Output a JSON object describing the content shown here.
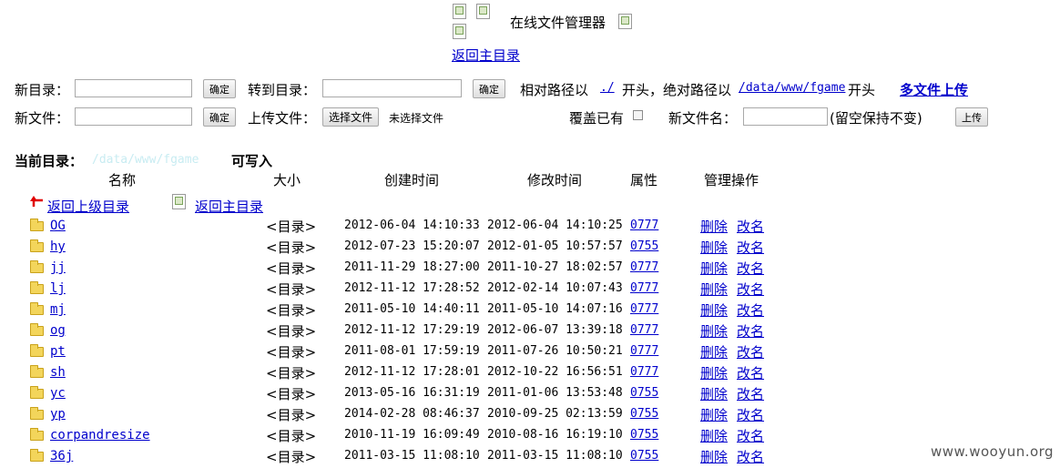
{
  "header": {
    "title": "在线文件管理器",
    "back_main": "返回主目录"
  },
  "toolbar": {
    "new_dir_label": "新目录：",
    "confirm": "确定",
    "goto_dir_label": "转到目录：",
    "path_hint_prefix": "相对路径以",
    "path_hint_rel": "./",
    "path_hint_mid": "开头，绝对路径以",
    "path_hint_abs": "/data/www/fgame",
    "path_hint_suffix": "开头",
    "multi_upload": "多文件上传",
    "new_file_label": "新文件：",
    "upload_file_label": "上传文件：",
    "choose_file": "选择文件",
    "no_file_chosen": "未选择文件",
    "overwrite_label": "覆盖已有",
    "new_filename_label": "新文件名：",
    "keep_hint": "(留空保持不变)",
    "upload_button": "上传"
  },
  "current_dir": {
    "label": "当前目录：",
    "path": "/data/www/fgame",
    "writable": "可写入"
  },
  "table": {
    "columns": [
      "名称",
      "大小",
      "创建时间",
      "修改时间",
      "属性",
      "管理操作"
    ],
    "up_level": "返回上级目录",
    "back_main": "返回主目录",
    "rows": [
      {
        "name": "OG",
        "size": "<目录>",
        "ctime": "2012-06-04 14:10:33",
        "mtime": "2012-06-04 14:10:25",
        "perm": "0777",
        "del": "删除",
        "ren": "改名"
      },
      {
        "name": "hy",
        "size": "<目录>",
        "ctime": "2012-07-23 15:20:07",
        "mtime": "2012-01-05 10:57:57",
        "perm": "0755",
        "del": "删除",
        "ren": "改名"
      },
      {
        "name": "jj",
        "size": "<目录>",
        "ctime": "2011-11-29 18:27:00",
        "mtime": "2011-10-27 18:02:57",
        "perm": "0777",
        "del": "删除",
        "ren": "改名"
      },
      {
        "name": "lj",
        "size": "<目录>",
        "ctime": "2012-11-12 17:28:52",
        "mtime": "2012-02-14 10:07:43",
        "perm": "0777",
        "del": "删除",
        "ren": "改名"
      },
      {
        "name": "mj",
        "size": "<目录>",
        "ctime": "2011-05-10 14:40:11",
        "mtime": "2011-05-10 14:07:16",
        "perm": "0777",
        "del": "删除",
        "ren": "改名"
      },
      {
        "name": "og",
        "size": "<目录>",
        "ctime": "2012-11-12 17:29:19",
        "mtime": "2012-06-07 13:39:18",
        "perm": "0777",
        "del": "删除",
        "ren": "改名"
      },
      {
        "name": "pt",
        "size": "<目录>",
        "ctime": "2011-08-01 17:59:19",
        "mtime": "2011-07-26 10:50:21",
        "perm": "0777",
        "del": "删除",
        "ren": "改名"
      },
      {
        "name": "sh",
        "size": "<目录>",
        "ctime": "2012-11-12 17:28:01",
        "mtime": "2012-10-22 16:56:51",
        "perm": "0777",
        "del": "删除",
        "ren": "改名"
      },
      {
        "name": "yc",
        "size": "<目录>",
        "ctime": "2013-05-16 16:31:19",
        "mtime": "2011-01-06 13:53:48",
        "perm": "0755",
        "del": "删除",
        "ren": "改名"
      },
      {
        "name": "yp",
        "size": "<目录>",
        "ctime": "2014-02-28 08:46:37",
        "mtime": "2010-09-25 02:13:59",
        "perm": "0755",
        "del": "删除",
        "ren": "改名"
      },
      {
        "name": "corpandresize",
        "size": "<目录>",
        "ctime": "2010-11-19 16:09:49",
        "mtime": "2010-08-16 16:19:10",
        "perm": "0755",
        "del": "删除",
        "ren": "改名"
      },
      {
        "name": "36j",
        "size": "<目录>",
        "ctime": "2011-03-15 11:08:10",
        "mtime": "2011-03-15 11:08:10",
        "perm": "0755",
        "del": "删除",
        "ren": "改名"
      }
    ]
  },
  "watermark": "www.wooyun.org"
}
